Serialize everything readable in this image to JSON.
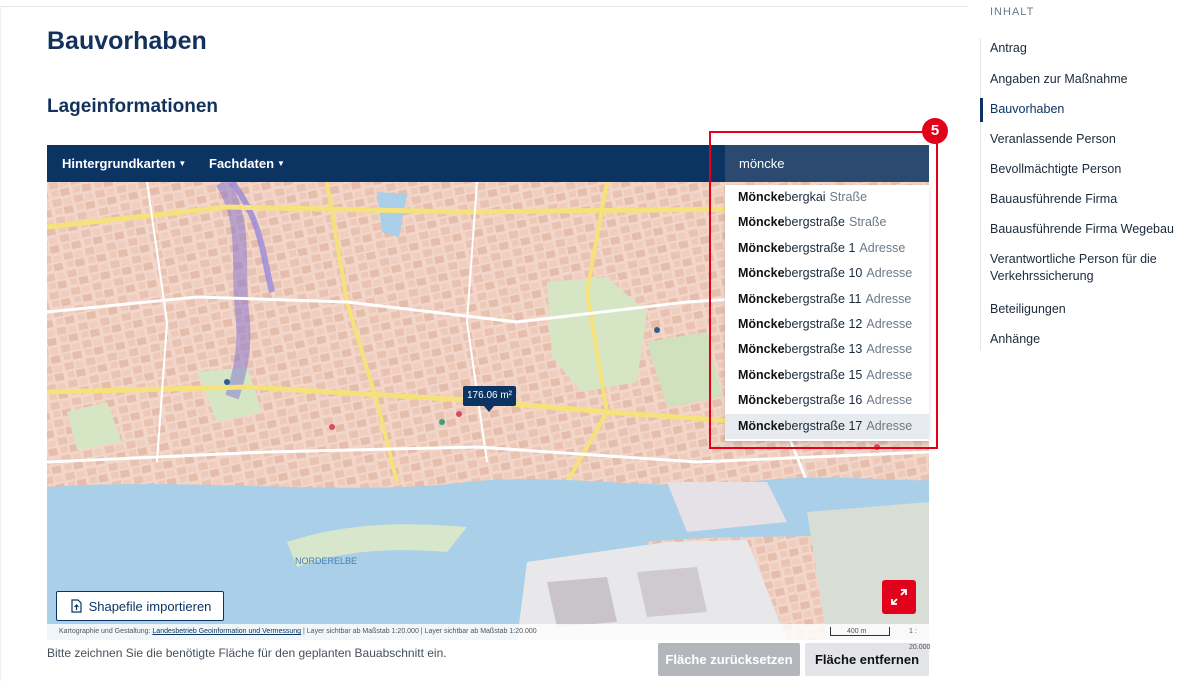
{
  "page": {
    "title": "Bauvorhaben",
    "section_title": "Lageinformationen",
    "hint": "Bitte zeichnen Sie die benötigte Fläche für den geplanten Bauabschnitt ein."
  },
  "map": {
    "toolbar": {
      "background_maps": "Hintergrundkarten",
      "special_data": "Fachdaten"
    },
    "search": {
      "value": "möncke",
      "suggestions": [
        {
          "match": "Möncke",
          "rest": "bergkai",
          "type": "Straße"
        },
        {
          "match": "Möncke",
          "rest": "bergstraße",
          "type": "Straße"
        },
        {
          "match": "Möncke",
          "rest": "bergstraße 1",
          "type": "Adresse"
        },
        {
          "match": "Möncke",
          "rest": "bergstraße 10",
          "type": "Adresse"
        },
        {
          "match": "Möncke",
          "rest": "bergstraße 11",
          "type": "Adresse"
        },
        {
          "match": "Möncke",
          "rest": "bergstraße 12",
          "type": "Adresse"
        },
        {
          "match": "Möncke",
          "rest": "bergstraße 13",
          "type": "Adresse"
        },
        {
          "match": "Möncke",
          "rest": "bergstraße 15",
          "type": "Adresse"
        },
        {
          "match": "Möncke",
          "rest": "bergstraße 16",
          "type": "Adresse"
        },
        {
          "match": "Möncke",
          "rest": "bergstraße 17",
          "type": "Adresse"
        }
      ]
    },
    "area_label": "176.06 m²",
    "river_label": "NORDERELBE",
    "shapefile_button": "Shapefile importieren",
    "attribution": {
      "prefix": "Kartographie und Gestaltung:",
      "link": "Landesbetrieb Geoinformation und Vermessung",
      "suffix": "| Layer sichtbar ab Maßstab 1:20.000 | Layer sichtbar ab Maßstab 1:20.000"
    },
    "scale_label": "400 m",
    "scale_ratio": "1 : 20.000"
  },
  "buttons": {
    "reset": "Fläche zurücksetzen",
    "remove": "Fläche entfernen"
  },
  "callout": {
    "number": "5"
  },
  "toc": {
    "heading": "INHALT",
    "items": [
      "Antrag",
      "Angaben zur Maßnahme",
      "Bauvorhaben",
      "Veranlassende Person",
      "Bevollmächtigte Person",
      "Bauausführende Firma",
      "Bauausführende Firma Wegebau",
      "Verantwortliche Person für die Verkehrssicherung",
      "Beteiligungen",
      "Anhänge"
    ],
    "active": "Bauvorhaben"
  },
  "colors": {
    "brand": "#0c3463",
    "accent": "#e2001a",
    "map_land": "#f2ded4",
    "map_water": "#a9cfe9"
  }
}
